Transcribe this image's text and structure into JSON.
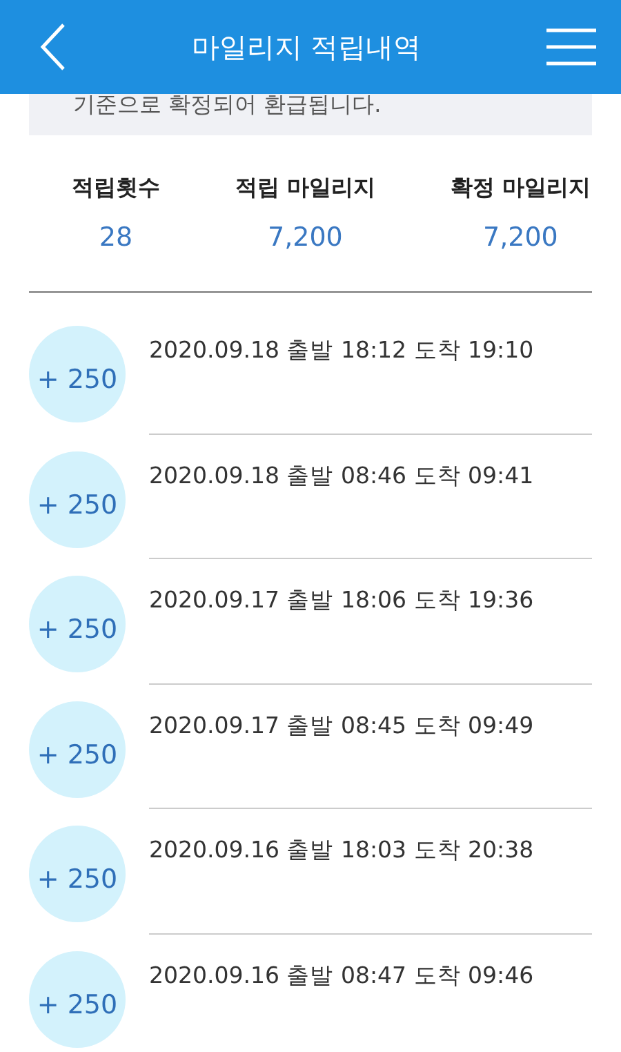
{
  "header": {
    "title": "마일리지 적립내역"
  },
  "notice": "기준으로 확정되어 환급됩니다.",
  "stats": [
    {
      "label": "적립횟수",
      "value": "28"
    },
    {
      "label": "적립 마일리지",
      "value": "7,200"
    },
    {
      "label": "확정 마일리지",
      "value": "7,200"
    }
  ],
  "entries": [
    {
      "points": "+ 250",
      "date": "2020.09.18",
      "depart_label": "출발",
      "depart": "18:12",
      "arrive_label": "도착",
      "arrive": "19:10"
    },
    {
      "points": "+ 250",
      "date": "2020.09.18",
      "depart_label": "출발",
      "depart": "08:46",
      "arrive_label": "도착",
      "arrive": "09:41"
    },
    {
      "points": "+ 250",
      "date": "2020.09.17",
      "depart_label": "출발",
      "depart": "18:06",
      "arrive_label": "도착",
      "arrive": "19:36"
    },
    {
      "points": "+ 250",
      "date": "2020.09.17",
      "depart_label": "출발",
      "depart": "08:45",
      "arrive_label": "도착",
      "arrive": "09:49"
    },
    {
      "points": "+ 250",
      "date": "2020.09.16",
      "depart_label": "출발",
      "depart": "18:03",
      "arrive_label": "도착",
      "arrive": "20:38"
    },
    {
      "points": "+ 250",
      "date": "2020.09.16",
      "depart_label": "출발",
      "depart": "08:47",
      "arrive_label": "도착",
      "arrive": "09:46"
    }
  ]
}
